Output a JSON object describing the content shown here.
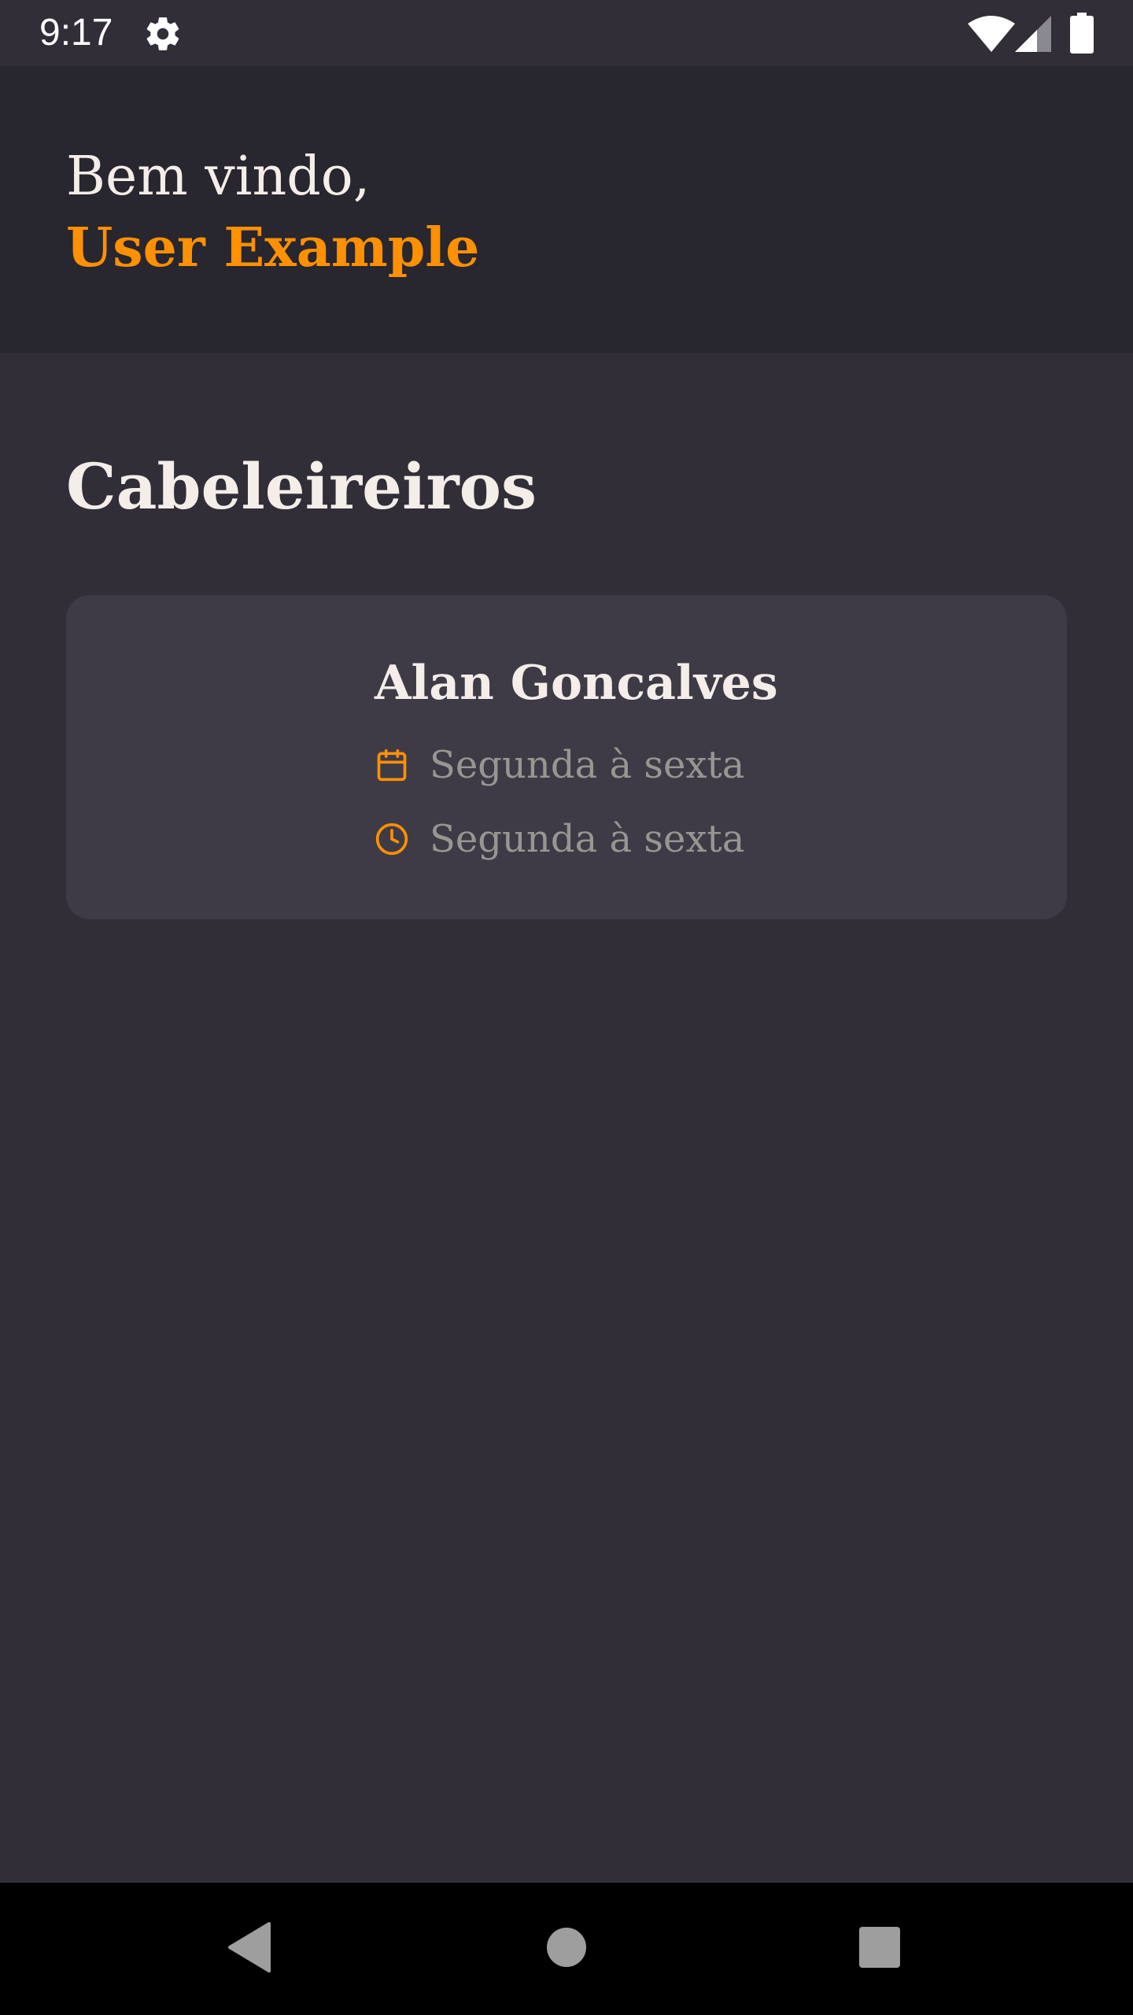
{
  "status_bar": {
    "time": "9:17",
    "icons": [
      "gear-icon",
      "wifi-icon",
      "signal-icon",
      "battery-icon"
    ]
  },
  "header": {
    "greeting": "Bem vindo,",
    "user_name": "User Example"
  },
  "main": {
    "section_title": "Cabeleireiros",
    "providers": [
      {
        "name": "Alan Goncalves",
        "days": "Segunda à sexta",
        "hours": "Segunda à sexta"
      }
    ]
  },
  "nav_bar": {
    "icons": [
      "back-icon",
      "home-icon",
      "recent-apps-icon"
    ]
  },
  "colors": {
    "background": "#312e38",
    "header_background": "#28262e",
    "card_background": "#3e3b47",
    "accent": "#ff9000",
    "text_primary": "#f4ede8",
    "text_secondary": "#999591"
  }
}
